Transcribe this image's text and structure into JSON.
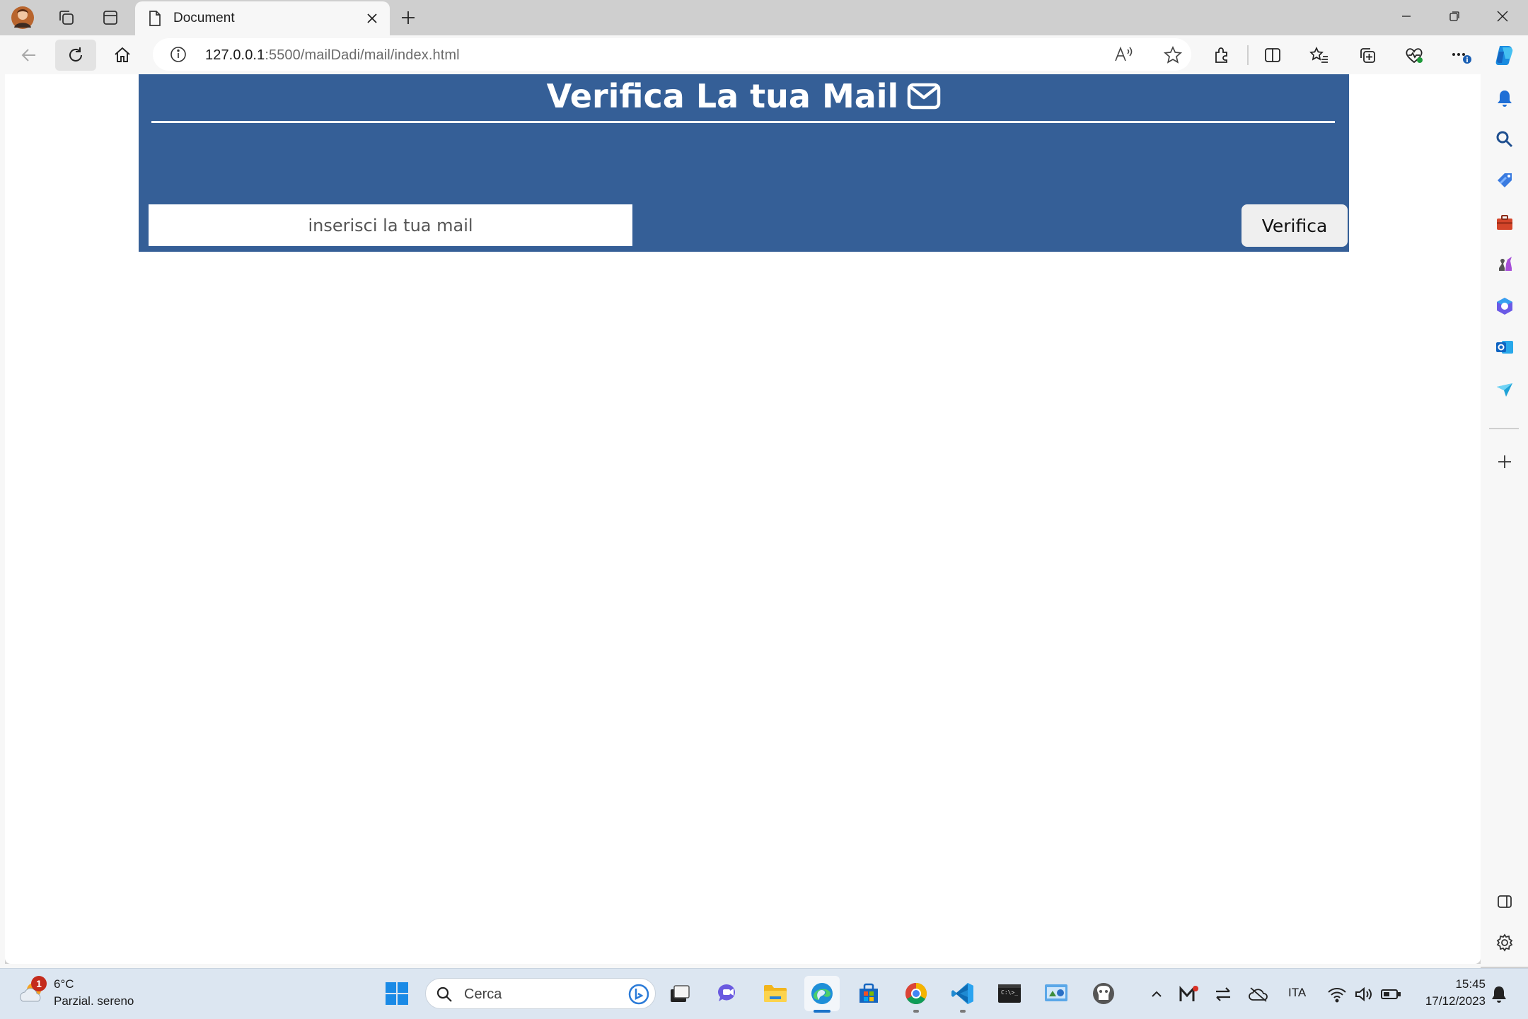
{
  "browser": {
    "tab_title": "Document",
    "url_host": "127.0.0.1",
    "url_rest": ":5500/mailDadi/mail/index.html"
  },
  "page": {
    "heading": "Verifica La tua Mail",
    "email_placeholder": "inserisci la tua mail",
    "verify_label": "Verifica",
    "panel_color": "#355f97"
  },
  "taskbar": {
    "weather_temp": "6°C",
    "weather_desc": "Parzial. sereno",
    "weather_badge": "1",
    "search_label": "Cerca",
    "language": "ITA",
    "time": "15:45",
    "date": "17/12/2023"
  }
}
